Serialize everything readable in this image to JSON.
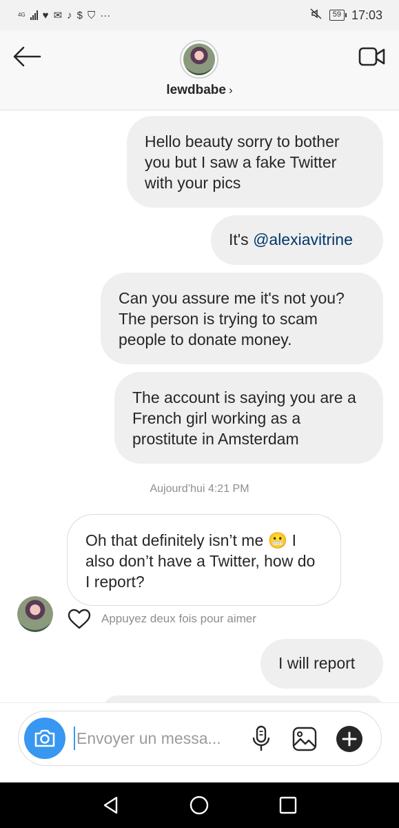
{
  "status_bar": {
    "network": "4G",
    "notification_icons": [
      "heart-icon",
      "mail-icon",
      "tiktok-icon",
      "dollar-icon",
      "shield-icon"
    ],
    "more": "···",
    "battery": "59",
    "time": "17:03"
  },
  "header": {
    "username": "lewdbabe",
    "chevron": "›"
  },
  "messages": [
    {
      "text": "Hello beauty sorry to bother you but I saw a fake Twitter with your pics"
    },
    {
      "prefix": "It's ",
      "mention": "@alexiavitrine"
    },
    {
      "text": "Can you assure me it's not you? The person is trying to scam people to donate money."
    },
    {
      "text": "The account is saying you are a French girl working as a prostitute in Amsterdam"
    },
    {
      "text": "Oh that definitely isn’t me 😬 I also don’t have a Twitter, how do I report?"
    },
    {
      "text": "I will report"
    }
  ],
  "timestamp": "Aujourd’hui 4:21 PM",
  "like_hint": "Appuyez deux fois pour aimer",
  "composer": {
    "placeholder": "Envoyer un messa..."
  },
  "colors": {
    "accent": "#3897f0",
    "sent_bubble": "#efefef",
    "mention": "#00376b"
  }
}
